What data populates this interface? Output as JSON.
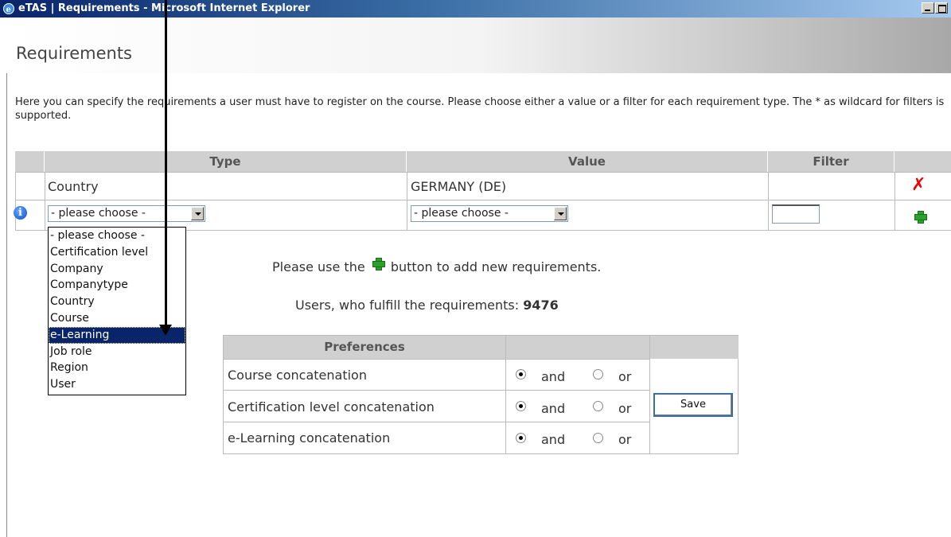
{
  "window": {
    "title": "eTAS | Requirements - Microsoft Internet Explorer"
  },
  "page": {
    "heading": "Requirements",
    "intro": "Here you can specify the requirements a user must have to register on the course. Please choose either a value or a filter for each requirement type. The * as wildcard for filters is supported."
  },
  "requirements_table": {
    "headers": [
      "Type",
      "Value",
      "Filter"
    ],
    "rows": [
      {
        "type": "Country",
        "value": "GERMANY (DE)",
        "filter": ""
      }
    ],
    "new_row": {
      "type_select": "- please choose -",
      "value_select": "- please choose -",
      "filter_value": ""
    }
  },
  "type_dropdown": {
    "options": [
      "- please choose -",
      "Certification level",
      "Company",
      "Companytype",
      "Country",
      "Course",
      "e-Learning",
      "Job role",
      "Region",
      "User"
    ],
    "highlighted": "e-Learning"
  },
  "hint": {
    "before": "Please use the",
    "after": "button to add new requirements."
  },
  "users": {
    "label": "Users, who fulfill the requirements:",
    "count": "9476"
  },
  "preferences": {
    "header": "Preferences",
    "rows": [
      {
        "label": "Course concatenation",
        "and": "and",
        "or": "or",
        "selected": "and"
      },
      {
        "label": "Certification level concatenation",
        "and": "and",
        "or": "or",
        "selected": "and"
      },
      {
        "label": "e-Learning concatenation",
        "and": "and",
        "or": "or",
        "selected": "and"
      }
    ],
    "save_label": "Save"
  },
  "icons": {
    "info": "info-icon",
    "delete": "delete-icon",
    "add": "plus-icon",
    "delete_color": "#e00000",
    "add_color": "#2aa12a"
  }
}
